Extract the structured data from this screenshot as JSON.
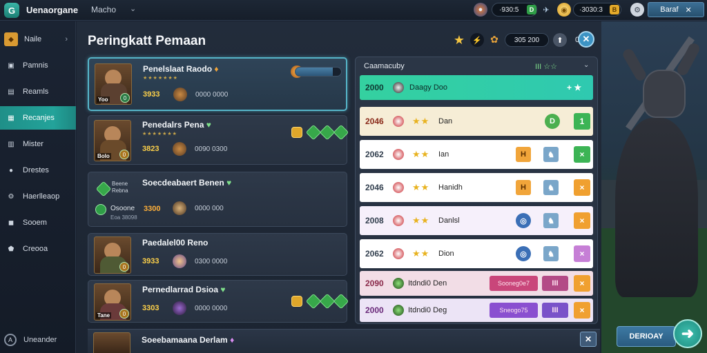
{
  "app": {
    "name": "Uenaorgane",
    "subtitle": "Macho",
    "logo_letter": "G"
  },
  "topbar": {
    "res1_value": "·930:5",
    "res1_icon": "D",
    "res2_value": "·3030:3",
    "res2_icon": "B",
    "button_label": "Baraf",
    "button_close": "✕"
  },
  "sidebar": {
    "items": [
      {
        "label": "Naile",
        "icon": "◆"
      },
      {
        "label": "Pamnis",
        "icon": "▣"
      },
      {
        "label": "Reamls",
        "icon": "▤"
      },
      {
        "label": "Recanjes",
        "icon": "▦"
      },
      {
        "label": "Mister",
        "icon": "▥"
      },
      {
        "label": "Drestes",
        "icon": "●"
      },
      {
        "label": "Haerlleaop",
        "icon": "⚙"
      },
      {
        "label": "Sooem",
        "icon": "◼"
      },
      {
        "label": "Creooa",
        "icon": "⬟"
      }
    ],
    "footer_label": "Uneander",
    "footer_icon": "A"
  },
  "main": {
    "title": "Peringkatt Pemaan",
    "header_value": "305 200",
    "header_zero": "0",
    "close": "✕"
  },
  "players": [
    {
      "name": "Penelslaat Raodo",
      "badge": "♦",
      "stars": "★★★★★★★",
      "score": "3933",
      "stat": "0000 0000",
      "tag": "Yoo",
      "level": "0"
    },
    {
      "name": "Penedalrs Pena",
      "badge": "♥",
      "stars": "★★★★★★★",
      "score": "3823",
      "stat": "0090 0300",
      "tag": "Bolo",
      "level": "0"
    },
    {
      "name": "Soecdeabaert Benen",
      "badge": "♥",
      "sublabel": "Beene Rebna",
      "stat_label": "Osoone",
      "tag_small": "Eoa 38098",
      "score": "3300",
      "stat": "0000 000"
    },
    {
      "name": "Paedalel00 Reno",
      "badge": "",
      "score": "3933",
      "stat": "0300 0000",
      "tag": "",
      "level": "0"
    },
    {
      "name": "Pernedlarrad Dsioa",
      "badge": "♥",
      "score": "3303",
      "stat": "0000 0000",
      "tag": "Tane",
      "level": "0"
    }
  ],
  "bottom_player": {
    "name": "Soeebamaana Derlam",
    "badge": "♦"
  },
  "ranking": {
    "title": "Caamacuby",
    "right_label": "III ☆☆",
    "rows": [
      {
        "score": "2000",
        "name": "Daagy Doo",
        "action": "+ ★"
      },
      {
        "score": "2046",
        "name": "Dan",
        "icon": "D",
        "action": "1"
      },
      {
        "score": "2062",
        "name": "Ian",
        "icon": "H",
        "action": "×"
      },
      {
        "score": "2046",
        "name": "Hanidh",
        "icon": "H",
        "action": "×"
      },
      {
        "score": "2008",
        "name": "Danlsl",
        "icon": "◎",
        "action": "×"
      },
      {
        "score": "2062",
        "name": "Dion",
        "icon": "◎",
        "action": "×"
      },
      {
        "score": "2090",
        "name": "Itdndi0 Den",
        "pill": "Sooneg0e7",
        "roman": "III",
        "action": "×"
      },
      {
        "score": "2000",
        "name": "Itdndi0 Deg",
        "pill": "Sneogo75",
        "roman": "III",
        "action": "×"
      }
    ]
  },
  "cta": {
    "label": "DERIOAY",
    "arrow": "➜"
  }
}
